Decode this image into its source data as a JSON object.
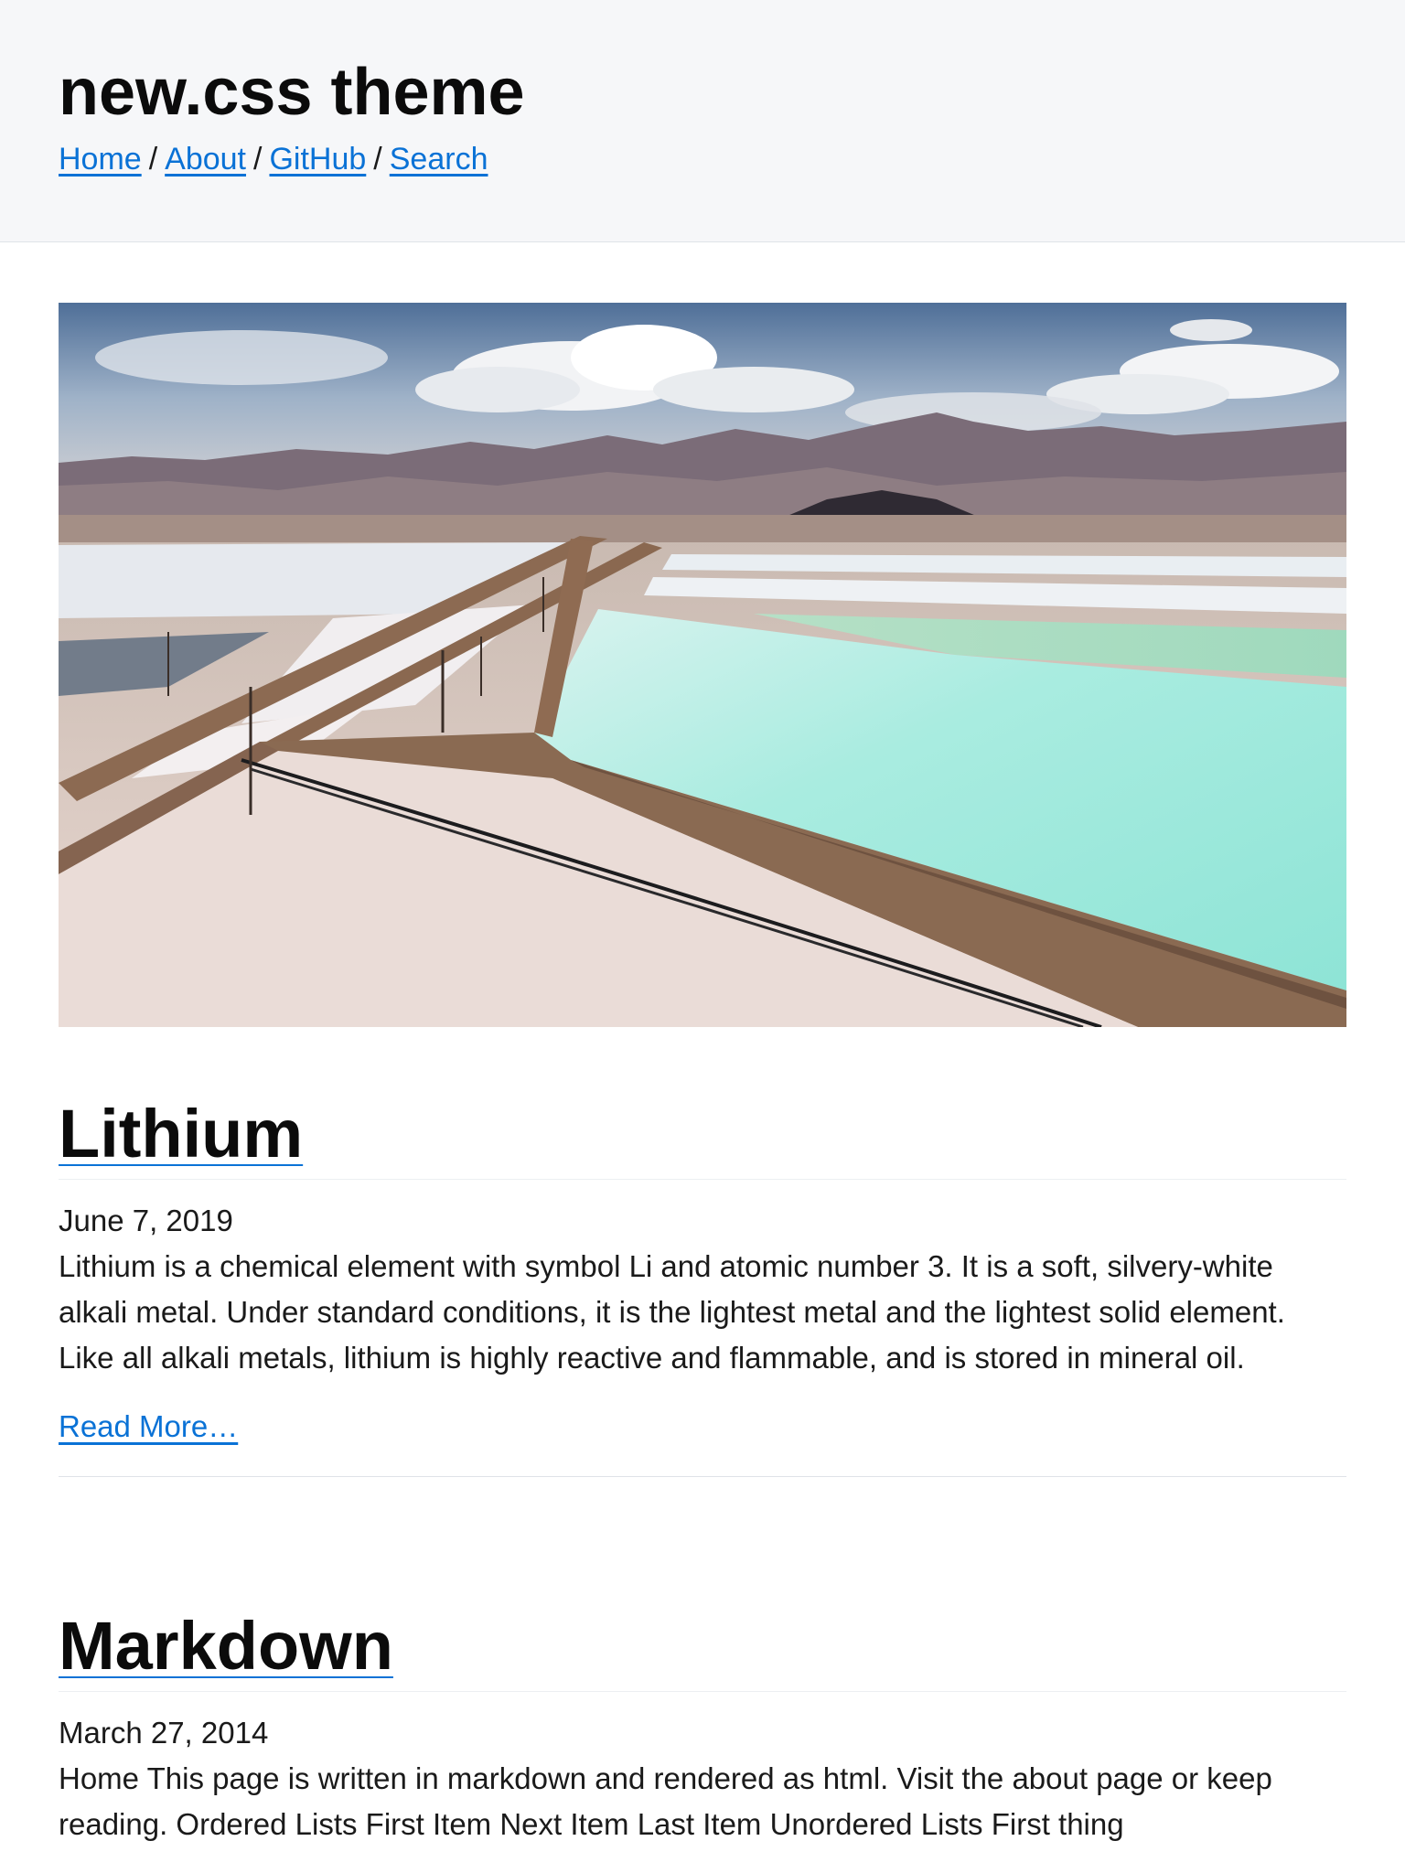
{
  "header": {
    "site_title": "new.css theme",
    "nav": [
      {
        "label": "Home"
      },
      {
        "label": "About"
      },
      {
        "label": "GitHub"
      },
      {
        "label": "Search"
      }
    ],
    "separator": "/"
  },
  "posts": [
    {
      "title": "Lithium",
      "date": "June 7, 2019",
      "excerpt": "Lithium is a chemical element with symbol Li and atomic number 3. It is a soft, silvery-white alkali metal. Under standard conditions, it is the lightest metal and the lightest solid element. Like all alkali metals, lithium is highly reactive and flammable, and is stored in mineral oil.",
      "read_more": "Read More…"
    },
    {
      "title": "Markdown",
      "date": "March 27, 2014",
      "excerpt": "Home This page is written in markdown and rendered as html. Visit the about page or keep reading. Ordered Lists First Item Next Item Last Item Unordered Lists First thing"
    }
  ],
  "colors": {
    "link": "#0a72d6",
    "header_bg": "#f6f7f9",
    "text": "#1a1a1a"
  }
}
